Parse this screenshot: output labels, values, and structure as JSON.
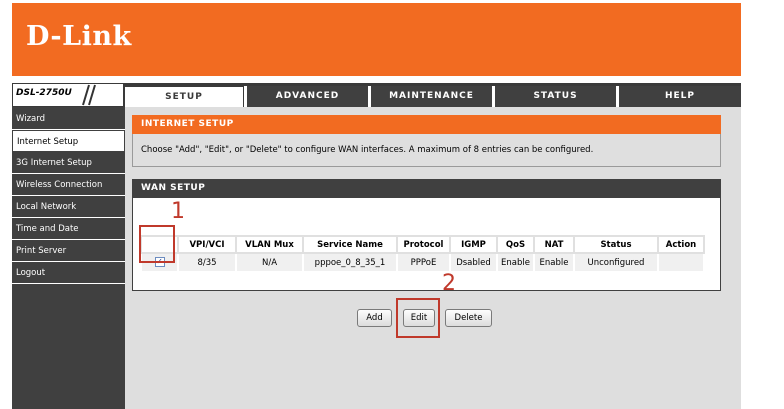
{
  "brand": {
    "logo_text": "D-Link"
  },
  "model": {
    "label": "DSL-2750U"
  },
  "tabs": [
    {
      "label": "SETUP",
      "active": true
    },
    {
      "label": "ADVANCED"
    },
    {
      "label": "MAINTENANCE"
    },
    {
      "label": "STATUS"
    },
    {
      "label": "HELP"
    }
  ],
  "sidebar": {
    "items": [
      {
        "label": "Wizard"
      },
      {
        "label": "Internet Setup",
        "active": true
      },
      {
        "label": "3G Internet Setup"
      },
      {
        "label": "Wireless Connection"
      },
      {
        "label": "Local Network"
      },
      {
        "label": "Time and Date"
      },
      {
        "label": "Print Server"
      },
      {
        "label": "Logout"
      }
    ]
  },
  "internet_setup": {
    "title": "INTERNET SETUP",
    "description": "Choose \"Add\", \"Edit\", or \"Delete\" to configure WAN interfaces. A maximum of 8 entries can be configured."
  },
  "wan_setup": {
    "title": "WAN SETUP",
    "columns": [
      "",
      "VPI/VCI",
      "VLAN Mux",
      "Service Name",
      "Protocol",
      "IGMP",
      "QoS",
      "NAT",
      "Status",
      "Action"
    ],
    "rows": [
      {
        "checked": true,
        "checkbox_glyph": "✓",
        "vpi_vci": "8/35",
        "vlan_mux": "N/A",
        "service_name": "pppoe_0_8_35_1",
        "protocol": "PPPoE",
        "igmp": "Dsabled",
        "qos": "Enable",
        "nat": "Enable",
        "status": "Unconfigured",
        "action": ""
      }
    ]
  },
  "buttons": {
    "add": "Add",
    "edit": "Edit",
    "delete": "Delete"
  },
  "annotations": {
    "marker_1": "1",
    "marker_2": "2"
  },
  "colors": {
    "brand_orange": "#f26b21",
    "dark_gray": "#404040",
    "annotation_red": "#c0392b"
  }
}
